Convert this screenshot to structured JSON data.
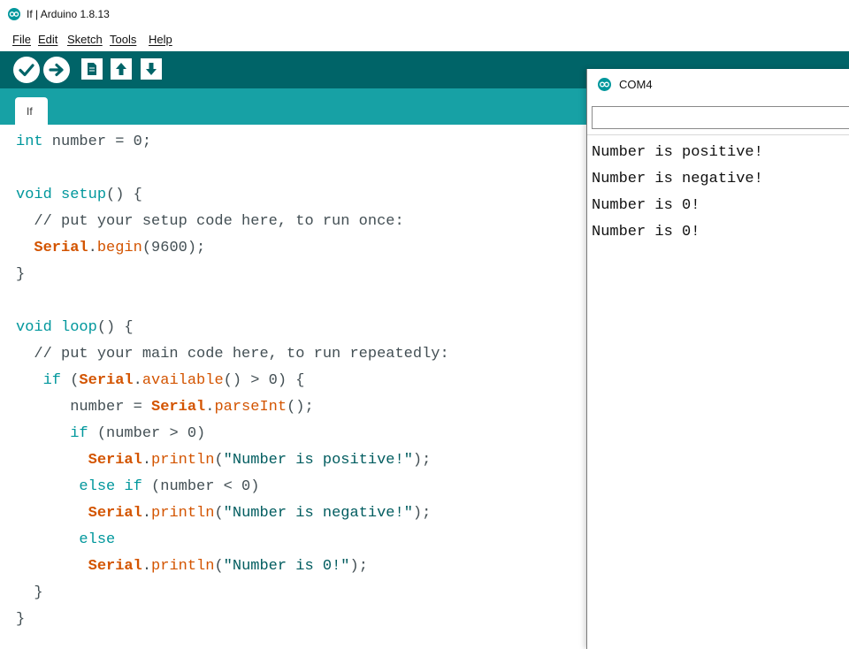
{
  "window": {
    "title": "If | Arduino 1.8.13",
    "app_icon": "arduino-logo-icon"
  },
  "menu": [
    {
      "label": "File"
    },
    {
      "label": "Edit"
    },
    {
      "label": "Sketch"
    },
    {
      "label": "Tools"
    },
    {
      "label": "Help"
    }
  ],
  "toolbar": {
    "buttons": [
      {
        "name": "verify",
        "icon": "checkmark-icon"
      },
      {
        "name": "upload",
        "icon": "arrow-right-icon"
      },
      {
        "name": "new",
        "icon": "new-document-icon"
      },
      {
        "name": "open",
        "icon": "arrow-up-icon"
      },
      {
        "name": "save",
        "icon": "arrow-down-icon"
      }
    ]
  },
  "tabs": [
    {
      "label": "If"
    }
  ],
  "code": [
    [
      {
        "t": "int",
        "c": "kw"
      },
      {
        "t": " number = 0;",
        "c": ""
      }
    ],
    [],
    [
      {
        "t": "void",
        "c": "kw"
      },
      {
        "t": " ",
        "c": ""
      },
      {
        "t": "setup",
        "c": "kw"
      },
      {
        "t": "() {",
        "c": ""
      }
    ],
    [
      {
        "t": "  // put your setup code here, to run once:",
        "c": "cmt"
      }
    ],
    [
      {
        "t": "  ",
        "c": ""
      },
      {
        "t": "Serial",
        "c": "cls"
      },
      {
        "t": ".",
        "c": ""
      },
      {
        "t": "begin",
        "c": "fn"
      },
      {
        "t": "(9600);",
        "c": ""
      }
    ],
    [
      {
        "t": "}",
        "c": ""
      }
    ],
    [],
    [
      {
        "t": "void",
        "c": "kw"
      },
      {
        "t": " ",
        "c": ""
      },
      {
        "t": "loop",
        "c": "kw"
      },
      {
        "t": "() {",
        "c": ""
      }
    ],
    [
      {
        "t": "  // put your main code here, to run repeatedly:",
        "c": "cmt"
      }
    ],
    [
      {
        "t": "   ",
        "c": ""
      },
      {
        "t": "if",
        "c": "kw"
      },
      {
        "t": " (",
        "c": ""
      },
      {
        "t": "Serial",
        "c": "cls"
      },
      {
        "t": ".",
        "c": ""
      },
      {
        "t": "available",
        "c": "fn"
      },
      {
        "t": "() > 0) {",
        "c": ""
      }
    ],
    [
      {
        "t": "      number = ",
        "c": ""
      },
      {
        "t": "Serial",
        "c": "cls"
      },
      {
        "t": ".",
        "c": ""
      },
      {
        "t": "parseInt",
        "c": "fn"
      },
      {
        "t": "();",
        "c": ""
      }
    ],
    [
      {
        "t": "      ",
        "c": ""
      },
      {
        "t": "if",
        "c": "kw"
      },
      {
        "t": " (number > 0)",
        "c": ""
      }
    ],
    [
      {
        "t": "        ",
        "c": ""
      },
      {
        "t": "Serial",
        "c": "cls"
      },
      {
        "t": ".",
        "c": ""
      },
      {
        "t": "println",
        "c": "fn"
      },
      {
        "t": "(",
        "c": ""
      },
      {
        "t": "\"Number is positive!\"",
        "c": "str"
      },
      {
        "t": ");",
        "c": ""
      }
    ],
    [
      {
        "t": "       ",
        "c": ""
      },
      {
        "t": "else",
        "c": "kw"
      },
      {
        "t": " ",
        "c": ""
      },
      {
        "t": "if",
        "c": "kw"
      },
      {
        "t": " (number < 0)",
        "c": ""
      }
    ],
    [
      {
        "t": "        ",
        "c": ""
      },
      {
        "t": "Serial",
        "c": "cls"
      },
      {
        "t": ".",
        "c": ""
      },
      {
        "t": "println",
        "c": "fn"
      },
      {
        "t": "(",
        "c": ""
      },
      {
        "t": "\"Number is negative!\"",
        "c": "str"
      },
      {
        "t": ");",
        "c": ""
      }
    ],
    [
      {
        "t": "       ",
        "c": ""
      },
      {
        "t": "else",
        "c": "kw"
      }
    ],
    [
      {
        "t": "        ",
        "c": ""
      },
      {
        "t": "Serial",
        "c": "cls"
      },
      {
        "t": ".",
        "c": ""
      },
      {
        "t": "println",
        "c": "fn"
      },
      {
        "t": "(",
        "c": ""
      },
      {
        "t": "\"Number is 0!\"",
        "c": "str"
      },
      {
        "t": ");",
        "c": ""
      }
    ],
    [
      {
        "t": "  }",
        "c": ""
      }
    ],
    [
      {
        "t": "}",
        "c": ""
      }
    ]
  ],
  "serial_monitor": {
    "title": "COM4",
    "icon": "arduino-logo-icon",
    "input_value": "",
    "output": [
      "Number is positive!",
      "Number is negative!",
      "Number is 0!",
      "Number is 0!"
    ]
  },
  "colors": {
    "toolbar": "#006468",
    "tabstrip": "#17a1a5",
    "keyword": "#00979c",
    "serial_class": "#d35400",
    "string": "#005c5f",
    "text": "#434f54"
  }
}
